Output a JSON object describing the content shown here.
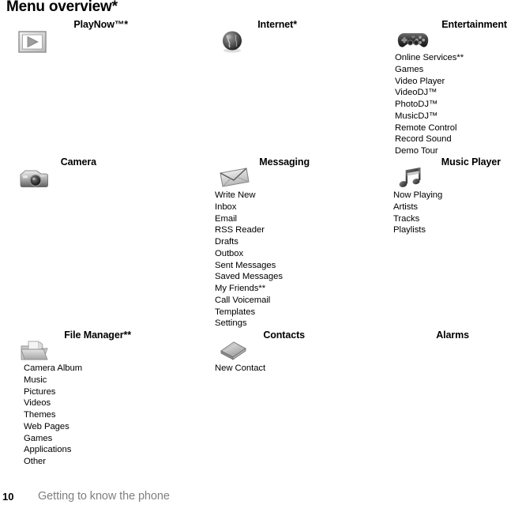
{
  "page": {
    "title": "Menu overview*",
    "footer_page_number": "10",
    "footer_text": "Getting to know the phone"
  },
  "colors": {
    "text": "#000000",
    "footer_text": "#808080",
    "background": "#ffffff",
    "icon_dark": "#3b3b3b",
    "icon_mid": "#8a8a8a",
    "icon_light": "#cfcfcf"
  },
  "menu": {
    "blocks": [
      {
        "id": "playnow",
        "title": "PlayNow™*",
        "icon": "playnow-icon",
        "items": []
      },
      {
        "id": "internet",
        "title": "Internet*",
        "icon": "globe-icon",
        "items": []
      },
      {
        "id": "entertainment",
        "title": "Entertainment",
        "icon": "gamepad-icon",
        "items": [
          "Online Services**",
          "Games",
          "Video Player",
          "VideoDJ™",
          "PhotoDJ™",
          "MusicDJ™",
          "Remote Control",
          "Record Sound",
          "Demo Tour"
        ]
      },
      {
        "id": "camera",
        "title": "Camera",
        "icon": "camera-icon",
        "items": []
      },
      {
        "id": "messaging",
        "title": "Messaging",
        "icon": "envelope-icon",
        "items": [
          "Write New",
          "Inbox",
          "Email",
          "RSS Reader",
          "Drafts",
          "Outbox",
          "Sent Messages",
          "Saved Messages",
          "My Friends**",
          "Call Voicemail",
          "Templates",
          "Settings"
        ]
      },
      {
        "id": "music-player",
        "title": "Music Player",
        "icon": "music-note-icon",
        "items": [
          "Now Playing",
          "Artists",
          "Tracks",
          "Playlists"
        ]
      },
      {
        "id": "file-manager",
        "title": "File Manager**",
        "icon": "folder-icon",
        "items": [
          "Camera Album",
          "Music",
          "Pictures",
          "Videos",
          "Themes",
          "Web Pages",
          "Games",
          "Applications",
          "Other"
        ]
      },
      {
        "id": "contacts",
        "title": "Contacts",
        "icon": "contacts-book-icon",
        "items": [
          "New Contact"
        ]
      },
      {
        "id": "alarms",
        "title": "Alarms",
        "icon": "alarm-clock-icon",
        "items": []
      }
    ]
  }
}
